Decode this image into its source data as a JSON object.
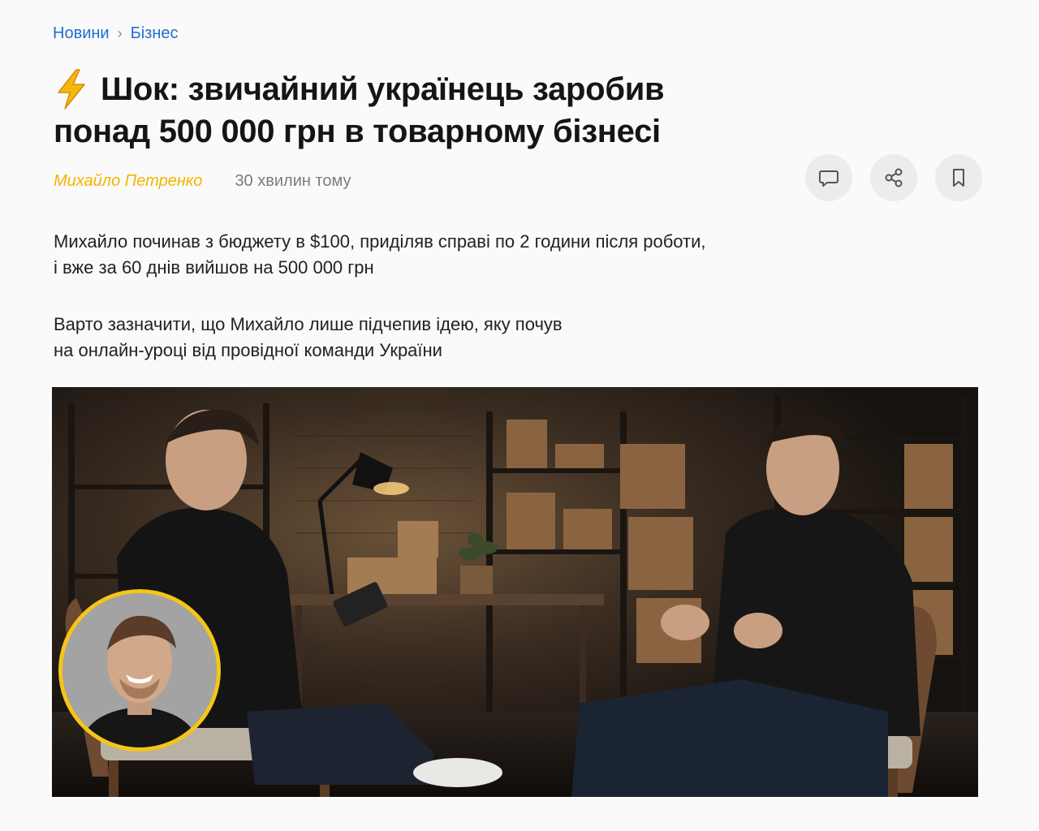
{
  "breadcrumb": {
    "home": "Новини",
    "separator": "›",
    "section": "Бізнес"
  },
  "article": {
    "headline_line1": "Шок: звичайний українець заробив",
    "headline_line2": "понад 500 000 грн в товарному бізнесі",
    "headline_icon": "lightning-icon",
    "author": "Михайло Петренко",
    "time": "30 хвилин тому",
    "paragraph1_line1": "Михайло починав з бюджету в $100, приділяв справі по 2 години після роботи,",
    "paragraph1_line2": "і вже за 60 днів вийшов на 500 000 грн",
    "paragraph2_line1": "Варто зазначити, що Михайло лише підчепив ідею, яку почув",
    "paragraph2_line2": "на онлайн-уроці від провідної команди України"
  },
  "actions": [
    {
      "name": "comment-icon"
    },
    {
      "name": "share-icon"
    },
    {
      "name": "bookmark-icon"
    }
  ],
  "colors": {
    "link": "#1f6fd0",
    "author": "#f2b400",
    "avatar_ring": "#f5c518",
    "action_bg": "#ececec"
  }
}
